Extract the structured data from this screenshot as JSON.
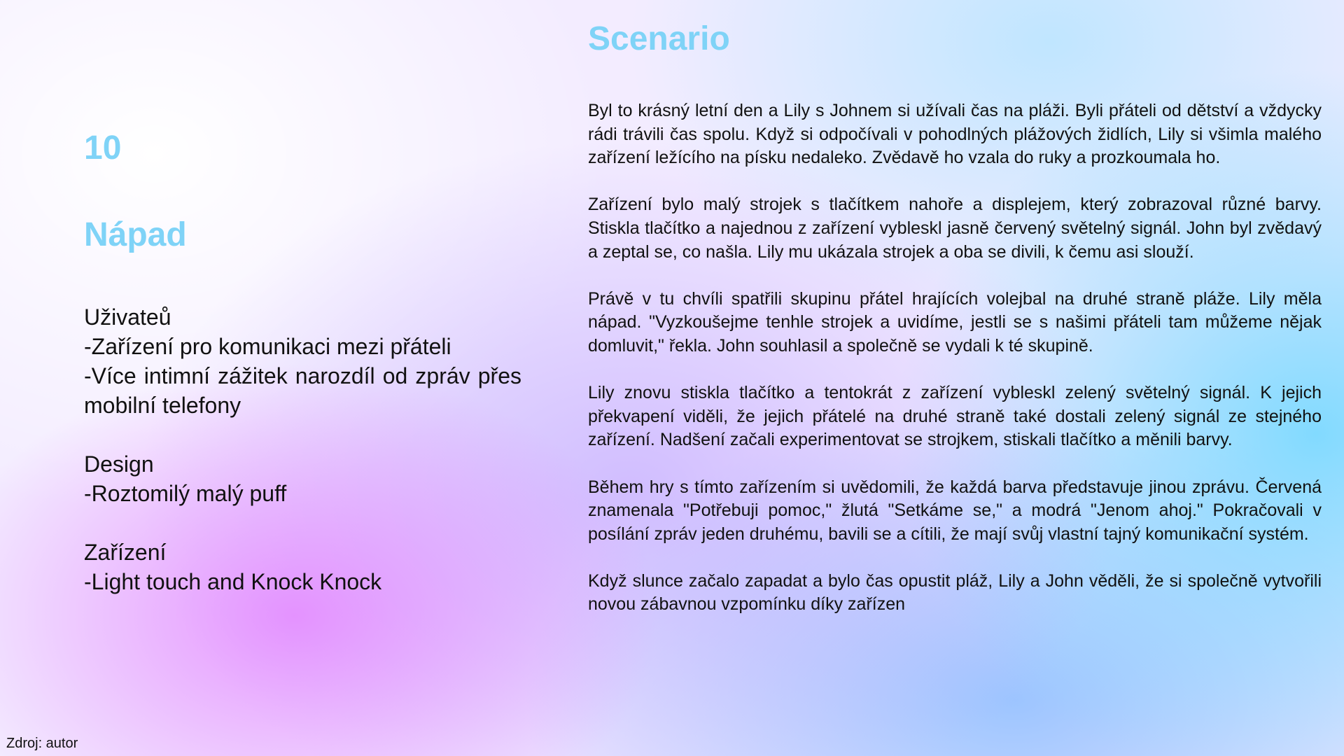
{
  "left": {
    "slide_number": "10",
    "title": "Nápad",
    "sections": [
      {
        "heading": "Uživateů",
        "lines": [
          "-Zařízení pro komunikaci mezi přáteli",
          "-Více intimní zážitek narozdíl od zpráv přes mobilní telefony"
        ]
      },
      {
        "heading": "Design",
        "lines": [
          "-Roztomilý malý puff"
        ]
      },
      {
        "heading": "Zařízení",
        "lines": [
          "-Light touch and Knock Knock"
        ]
      }
    ]
  },
  "scenario": {
    "title": "Scenario",
    "paragraphs": [
      "Byl to krásný letní den a Lily s Johnem si užívali čas na pláži. Byli přáteli od dětství a vždycky rádi trávili čas spolu. Když si odpočívali v pohodlných plážových židlích, Lily si všimla malého zařízení ležícího na písku nedaleko. Zvědavě ho vzala do ruky a prozkoumala ho.",
      "Zařízení bylo malý strojek s tlačítkem nahoře a displejem, který zobrazoval různé barvy. Stiskla tlačítko a najednou z zařízení vybleskl jasně červený světelný signál. John byl zvědavý a zeptal se, co našla. Lily mu ukázala strojek a oba se divili, k čemu asi slouží.",
      "Právě v tu chvíli spatřili skupinu přátel hrajících volejbal na druhé straně pláže. Lily měla nápad. \"Vyzkoušejme tenhle strojek a uvidíme, jestli se s našimi přáteli tam můžeme nějak domluvit,\" řekla. John souhlasil a společně se vydali k té skupině.",
      "Lily znovu stiskla tlačítko a tentokrát z zařízení vybleskl zelený světelný signál. K jejich překvapení viděli, že jejich přátelé na druhé straně také dostali zelený signál ze stejného zařízení. Nadšení začali experimentovat se strojkem, stiskali tlačítko a měnili barvy.",
      "Během hry s tímto zařízením si uvědomili, že každá barva představuje jinou zprávu. Červená znamenala \"Potřebuji pomoc,\" žlutá \"Setkáme se,\" a modrá \"Jenom ahoj.\" Pokračovali v posílání zpráv jeden druhému, bavili se a cítili, že mají svůj vlastní tajný komunikační systém.",
      "Když slunce začalo zapadat a bylo čas opustit pláž, Lily a John věděli, že si společně vytvořili novou zábavnou vzpomínku díky zařízen"
    ]
  },
  "footer": {
    "source": "Zdroj: autor"
  },
  "colors": {
    "heading_accent": "#7fd3f7",
    "text": "#111111"
  }
}
